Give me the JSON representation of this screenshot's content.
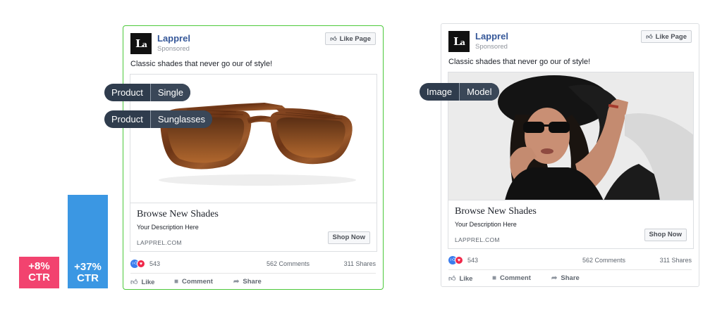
{
  "results": {
    "left_lift": [
      "+8%",
      "CTR"
    ],
    "right_lift": [
      "+37%",
      "CTR"
    ],
    "pink": "#f2436f",
    "blue": "#3b97e3"
  },
  "ads": [
    {
      "brand": "Lapprel",
      "sponsored": "Sponsored",
      "like_page": "Like Page",
      "caption": "Classic shades that never go our of style!",
      "link_title": "Browse New Shades",
      "link_desc": "Your Description Here",
      "domain": "LAPPREL.COM",
      "cta": "Shop Now",
      "reactions": "543",
      "comments": "562 Comments",
      "shares": "311 Shares",
      "actions": [
        "Like",
        "Comment",
        "Share"
      ],
      "tags": [
        [
          "Product",
          "Single"
        ],
        [
          "Product",
          "Sunglasses"
        ]
      ],
      "border_color": "#4cc93a"
    },
    {
      "brand": "Lapprel",
      "sponsored": "Sponsored",
      "like_page": "Like Page",
      "caption": "Classic shades that never go our of style!",
      "link_title": "Browse New Shades",
      "link_desc": "Your Description Here",
      "domain": "LAPPREL.COM",
      "cta": "Shop Now",
      "reactions": "543",
      "comments": "562 Comments",
      "shares": "311 Shares",
      "actions": [
        "Like",
        "Comment",
        "Share"
      ],
      "tags": [
        [
          "Image",
          "Model"
        ]
      ]
    }
  ],
  "icons": {
    "like_page": "thumbs-up-icon",
    "like": "thumbs-up-icon",
    "comment": "comment-bubble-icon",
    "share": "share-arrow-icon",
    "reaction_like": "like-reaction-icon",
    "reaction_love": "love-reaction-icon"
  }
}
